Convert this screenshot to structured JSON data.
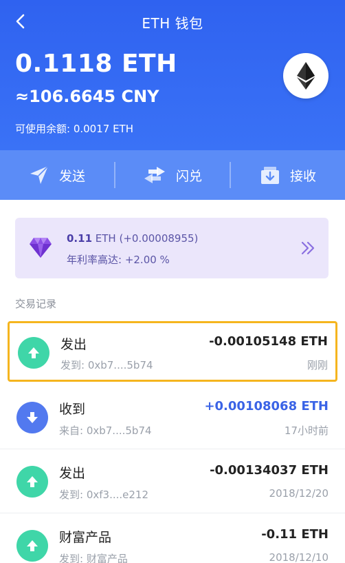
{
  "header": {
    "title": "ETH 钱包",
    "balance_eth": "0.1118 ETH",
    "balance_cny": "≈106.6645 CNY",
    "available": "可使用余额: 0.0017 ETH"
  },
  "actions": [
    {
      "label": "发送",
      "icon": "paper-plane-icon"
    },
    {
      "label": "闪兑",
      "icon": "swap-arrows-icon"
    },
    {
      "label": "接收",
      "icon": "receive-tray-icon"
    }
  ],
  "invest": {
    "amount": "0.11",
    "unit": " ETH (+0.00008955)",
    "rate": "年利率高达: +2.00 %"
  },
  "section_title": "交易记录",
  "transactions": [
    {
      "type": "out",
      "name": "发出",
      "addr": "发到: 0xb7....5b74",
      "amount": "-0.00105148 ETH",
      "time": "刚刚"
    },
    {
      "type": "in",
      "name": "收到",
      "addr": "来自: 0xb7....5b74",
      "amount": "+0.00108068 ETH",
      "time": "17小时前"
    },
    {
      "type": "out",
      "name": "发出",
      "addr": "发到: 0xf3....e212",
      "amount": "-0.00134037 ETH",
      "time": "2018/12/20"
    },
    {
      "type": "out",
      "name": "财富产品",
      "addr": "发到: 财富产品",
      "amount": "-0.11 ETH",
      "time": "2018/12/10"
    }
  ],
  "colors": {
    "header_blue": "#2f62f0",
    "action_bar": "#5b8cf7",
    "out_green": "#3fd6a8",
    "in_blue": "#5279ef",
    "highlight": "#f5b51e",
    "invest_bg": "#ebe6fb"
  }
}
